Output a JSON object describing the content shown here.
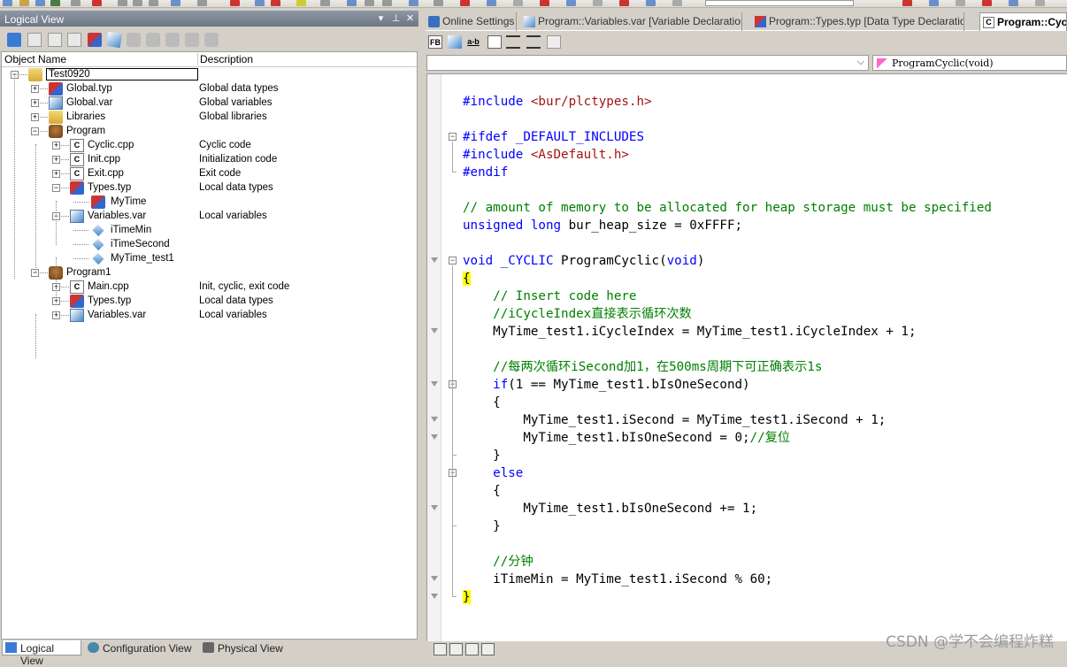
{
  "logical_view": {
    "title": "Logical View",
    "pin": "▾",
    "pushpin": "⊥",
    "close": "✕",
    "columns": {
      "name": "Object Name",
      "description": "Description"
    },
    "tree": [
      {
        "label": "Test0920",
        "desc": ""
      },
      {
        "label": "Global.typ",
        "desc": "Global data types"
      },
      {
        "label": "Global.var",
        "desc": "Global variables"
      },
      {
        "label": "Libraries",
        "desc": "Global libraries"
      },
      {
        "label": "Program",
        "desc": ""
      },
      {
        "label": "Cyclic.cpp",
        "desc": "Cyclic code"
      },
      {
        "label": "Init.cpp",
        "desc": "Initialization code"
      },
      {
        "label": "Exit.cpp",
        "desc": "Exit code"
      },
      {
        "label": "Types.typ",
        "desc": "Local data types"
      },
      {
        "label": "MyTime",
        "desc": ""
      },
      {
        "label": "Variables.var",
        "desc": "Local variables"
      },
      {
        "label": "iTimeMin",
        "desc": ""
      },
      {
        "label": "iTimeSecond",
        "desc": ""
      },
      {
        "label": "MyTime_test1",
        "desc": ""
      },
      {
        "label": "Program1",
        "desc": ""
      },
      {
        "label": "Main.cpp",
        "desc": "Init, cyclic, exit code"
      },
      {
        "label": "Types.typ",
        "desc": "Local data types"
      },
      {
        "label": "Variables.var",
        "desc": "Local variables"
      }
    ],
    "bottom_tabs": [
      "Logical View",
      "Configuration View",
      "Physical View"
    ]
  },
  "editor": {
    "tabs": [
      "Online Settings",
      "Program::Variables.var [Variable Declaration]",
      "Program::Types.typ [Data Type Declaration]",
      "Program::Cyclic.cpp"
    ],
    "toolbar_fb_label": "FB",
    "toolbar_ab_label": "a-b",
    "combo_left": "",
    "combo_right": "ProgramCyclic(void)",
    "combo_arrow": "⌵",
    "code_lines": [
      "",
      "#include <bur/plctypes.h>",
      "",
      "#ifdef _DEFAULT_INCLUDES",
      "#include <AsDefault.h>",
      "#endif",
      "",
      "// amount of memory to be allocated for heap storage must be specified",
      "unsigned long bur_heap_size = 0xFFFF;",
      "",
      "void _CYCLIC ProgramCyclic(void)",
      "{",
      "    // Insert code here",
      "    //iCycleIndex直接表示循环次数",
      "    MyTime_test1.iCycleIndex = MyTime_test1.iCycleIndex + 1;",
      "",
      "    //每两次循环iSecond加1，在500ms周期下可正确表示1s",
      "    if(1 == MyTime_test1.bIsOneSecond)",
      "    {",
      "        MyTime_test1.iSecond = MyTime_test1.iSecond + 1;",
      "        MyTime_test1.bIsOneSecond = 0;//复位",
      "    }",
      "    else",
      "    {",
      "        MyTime_test1.bIsOneSecond += 1;",
      "    }",
      "",
      "    //分钟",
      "    iTimeMin = MyTime_test1.iSecond % 60;",
      "}"
    ]
  },
  "watermark": "CSDN @学不会编程炸糕",
  "colors": {
    "keyword": "#0000ff",
    "comment": "#008000",
    "string": "#a31515",
    "highlight": "#ffff00"
  }
}
